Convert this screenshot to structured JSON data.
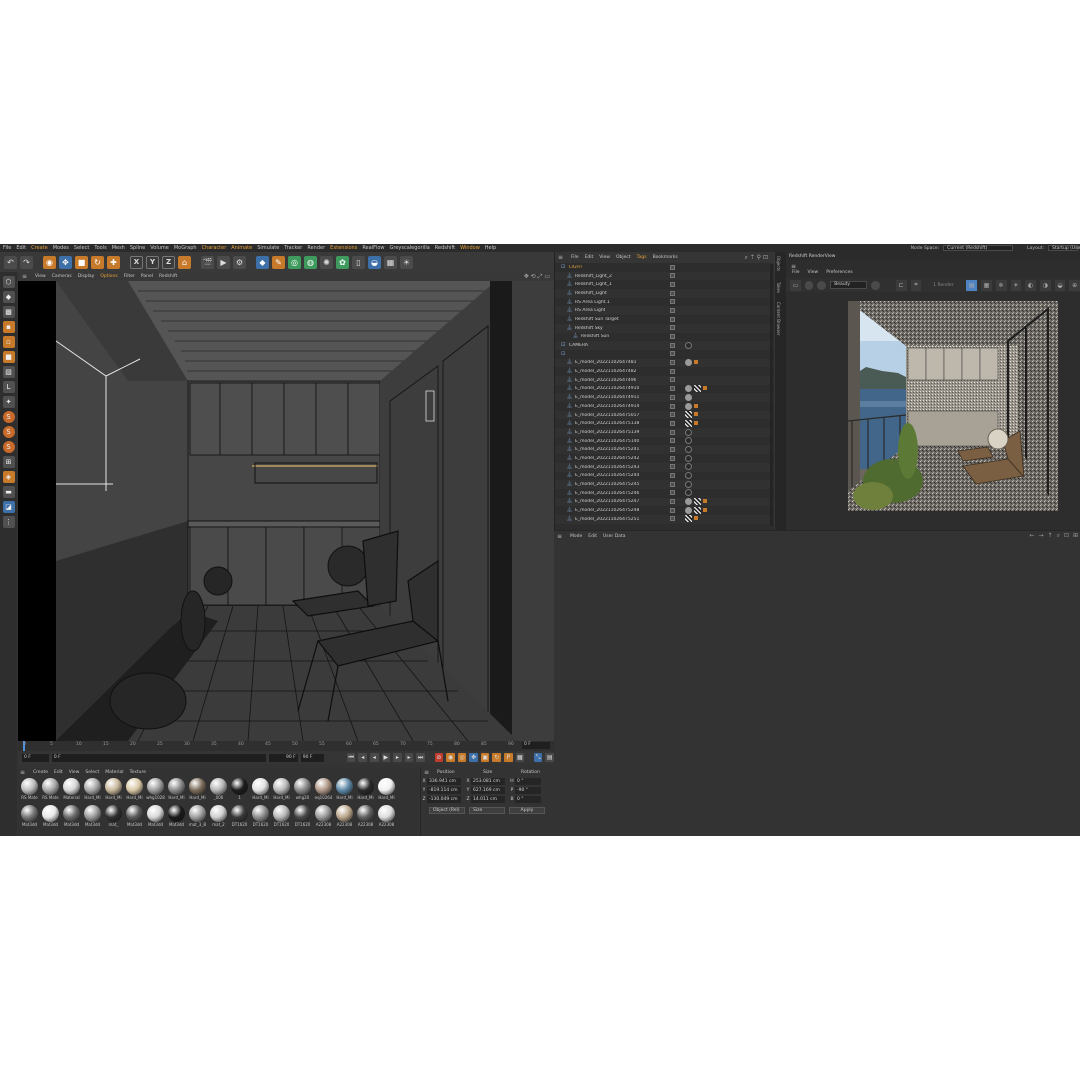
{
  "menubar": {
    "items": [
      "File",
      "Edit",
      "Create",
      "Modes",
      "Select",
      "Tools",
      "Mesh",
      "Spline",
      "Volume",
      "MoGraph",
      "Character",
      "Animate",
      "Simulate",
      "Tracker",
      "Render",
      "Extensions",
      "RealFlow",
      "Greyscalegorilla",
      "Redshift",
      "Window",
      "Help"
    ],
    "node_space_label": "Node Space:",
    "node_space_value": "Current (Redshift)",
    "layout_label": "Layout:",
    "layout_value": "Startup (User)"
  },
  "viewport": {
    "menu": [
      "View",
      "Cameras",
      "Display",
      "Options",
      "Filter",
      "Panel",
      "Redshift"
    ]
  },
  "timeline": {
    "ticks": [
      "0",
      "5",
      "10",
      "15",
      "20",
      "25",
      "30",
      "35",
      "40",
      "45",
      "50",
      "55",
      "60",
      "65",
      "70",
      "75",
      "80",
      "85",
      "90"
    ],
    "current_frame": "0 F",
    "start_field": "0 F",
    "min_field": "0 F",
    "max_field": "90 F",
    "end_field": "90 F"
  },
  "materials": {
    "menu": [
      "Create",
      "Edit",
      "View",
      "Select",
      "Material",
      "Texture"
    ],
    "items": [
      {
        "label": "RS Mate",
        "color": "#bcbcbc"
      },
      {
        "label": "RS Mate",
        "color": "#a8a8a8"
      },
      {
        "label": "Material",
        "color": "#d6d6d6"
      },
      {
        "label": "Hard_Mi",
        "color": "#a9a9a9"
      },
      {
        "label": "Hard_Mi",
        "color": "#c8b79a"
      },
      {
        "label": "Hard_Mi",
        "color": "#d9c8a6"
      },
      {
        "label": "whg1028",
        "color": "#9f9f9f"
      },
      {
        "label": "Hard_Mi",
        "color": "#8c8c8c"
      },
      {
        "label": "Hard_Mi",
        "color": "#7c6d5a"
      },
      {
        "label": "_006",
        "color": "#b5b5b5"
      },
      {
        "label": "1",
        "color": "#1c1c1c"
      },
      {
        "label": "Hard_Mi",
        "color": "#e2e2e2"
      },
      {
        "label": "Hard_Mi",
        "color": "#b9b9b9"
      },
      {
        "label": "whg20",
        "color": "#8a8a8a"
      },
      {
        "label": "eq10264",
        "color": "#b09888"
      },
      {
        "label": "Hard_Mi",
        "color": "#5e88a6"
      },
      {
        "label": "Hard_Mi",
        "color": "#2a2a2a"
      },
      {
        "label": "Hard_Mi",
        "color": "#f2f2f2"
      },
      {
        "label": "Mat3dd",
        "color": "#777777"
      },
      {
        "label": "Mat3dd",
        "color": "#e8e8e8"
      },
      {
        "label": "Mat3dd",
        "color": "#6a6a6a"
      },
      {
        "label": "Mat3dd",
        "color": "#9a9a9a"
      },
      {
        "label": "mat_",
        "color": "#303030"
      },
      {
        "label": "Mat3dd",
        "color": "#5a5a5a"
      },
      {
        "label": "Mat3dd",
        "color": "#d8d8d8"
      },
      {
        "label": "Mat3dd",
        "color": "#1a1a1a"
      },
      {
        "label": "mat_3_B",
        "color": "#a0a0a0"
      },
      {
        "label": "mat_2",
        "color": "#cfcfcf"
      },
      {
        "label": "DT1620",
        "color": "#3a3a3a"
      },
      {
        "label": "DT1620",
        "color": "#8f8f8f"
      },
      {
        "label": "DT1620",
        "color": "#b8b8b8"
      },
      {
        "label": "DT1620",
        "color": "#474747"
      },
      {
        "label": "A22308",
        "color": "#9b9b9b"
      },
      {
        "label": "A22308",
        "color": "#bba78c"
      },
      {
        "label": "A22308",
        "color": "#606060"
      },
      {
        "label": "A22308",
        "color": "#dddddd"
      }
    ]
  },
  "coordinates": {
    "headers": [
      "Position",
      "Size",
      "Rotation"
    ],
    "rows": [
      {
        "axis": "X",
        "pos": "336.941 cm",
        "size_axis": "X",
        "size": "253.081 cm",
        "rot_axis": "H",
        "rot": "0 °"
      },
      {
        "axis": "Y",
        "pos": "-819.114 cm",
        "size_axis": "Y",
        "size": "627.169 cm",
        "rot_axis": "P",
        "rot": "-90 °"
      },
      {
        "axis": "Z",
        "pos": "-130.049 cm",
        "size_axis": "Z",
        "size": "14.011 cm",
        "rot_axis": "B",
        "rot": "0 °"
      }
    ],
    "mode": "Object (Rel)",
    "size_mode": "Size",
    "apply": "Apply"
  },
  "objects": {
    "menu": [
      "File",
      "Edit",
      "View",
      "Object",
      "Tags",
      "Bookmarks"
    ],
    "rows": [
      {
        "name": "LIGHT",
        "indent": 0,
        "highlight": true,
        "tags": []
      },
      {
        "name": "Redshift_Light_2",
        "indent": 1,
        "tags": []
      },
      {
        "name": "Redshift_Light_1",
        "indent": 1,
        "tags": []
      },
      {
        "name": "Redshift_Light",
        "indent": 1,
        "tags": []
      },
      {
        "name": "RS Area Light.1",
        "indent": 1,
        "tags": []
      },
      {
        "name": "RS Area Light",
        "indent": 1,
        "tags": []
      },
      {
        "name": "Redshift Sun Target",
        "indent": 1,
        "tags": []
      },
      {
        "name": "Redshift Sky",
        "indent": 1,
        "tags": []
      },
      {
        "name": "Redshift Sun",
        "indent": 2,
        "tags": []
      },
      {
        "name": "CAMERA",
        "indent": 0,
        "tags": [
          "dk"
        ]
      },
      {
        "name": "",
        "indent": 0,
        "tags": []
      },
      {
        "name": "E_model_20221102647481",
        "indent": 1,
        "tags": [
          "ball",
          "or"
        ]
      },
      {
        "name": "E_model_20221102647482",
        "indent": 1,
        "tags": []
      },
      {
        "name": "E_model_20221102647496",
        "indent": 1,
        "tags": []
      },
      {
        "name": "E_model_202211026474910",
        "indent": 1,
        "tags": [
          "ball",
          "chk",
          "or"
        ]
      },
      {
        "name": "E_model_202211026474911",
        "indent": 1,
        "tags": [
          "ball"
        ]
      },
      {
        "name": "E_model_202211026474914",
        "indent": 1,
        "tags": [
          "ball",
          "or"
        ]
      },
      {
        "name": "E_model_202211026475017",
        "indent": 1,
        "tags": [
          "chk",
          "or"
        ]
      },
      {
        "name": "E_model_202211026475138",
        "indent": 1,
        "tags": [
          "chk",
          "or"
        ]
      },
      {
        "name": "E_model_202211026475139",
        "indent": 1,
        "tags": [
          "dk"
        ]
      },
      {
        "name": "E_model_202211026475140",
        "indent": 1,
        "tags": [
          "dk"
        ]
      },
      {
        "name": "E_model_202211026475241",
        "indent": 1,
        "tags": [
          "dk"
        ]
      },
      {
        "name": "E_model_202211026475242",
        "indent": 1,
        "tags": [
          "dk"
        ]
      },
      {
        "name": "E_model_202211026475243",
        "indent": 1,
        "tags": [
          "dk"
        ]
      },
      {
        "name": "E_model_202211026475244",
        "indent": 1,
        "tags": [
          "dk"
        ]
      },
      {
        "name": "E_model_202211026475245",
        "indent": 1,
        "tags": [
          "dk"
        ]
      },
      {
        "name": "E_model_202211026475246",
        "indent": 1,
        "tags": [
          "dk"
        ]
      },
      {
        "name": "E_model_202211026475247",
        "indent": 1,
        "tags": [
          "ball",
          "chk",
          "or"
        ]
      },
      {
        "name": "E_model_202211026475248",
        "indent": 1,
        "tags": [
          "ball",
          "chk",
          "or"
        ]
      },
      {
        "name": "E_model_202211026475251",
        "indent": 1,
        "tags": [
          "chk",
          "or"
        ]
      }
    ]
  },
  "side_tabs": [
    "Objects",
    "Takes",
    "Content Browser"
  ],
  "renderview": {
    "title": "Redshift RenderView",
    "menu": [
      "File",
      "View",
      "Preferences"
    ],
    "aov": "Beauty",
    "preset": "1 Render"
  },
  "attributes": {
    "menu": [
      "Mode",
      "Edit",
      "User Data"
    ]
  }
}
